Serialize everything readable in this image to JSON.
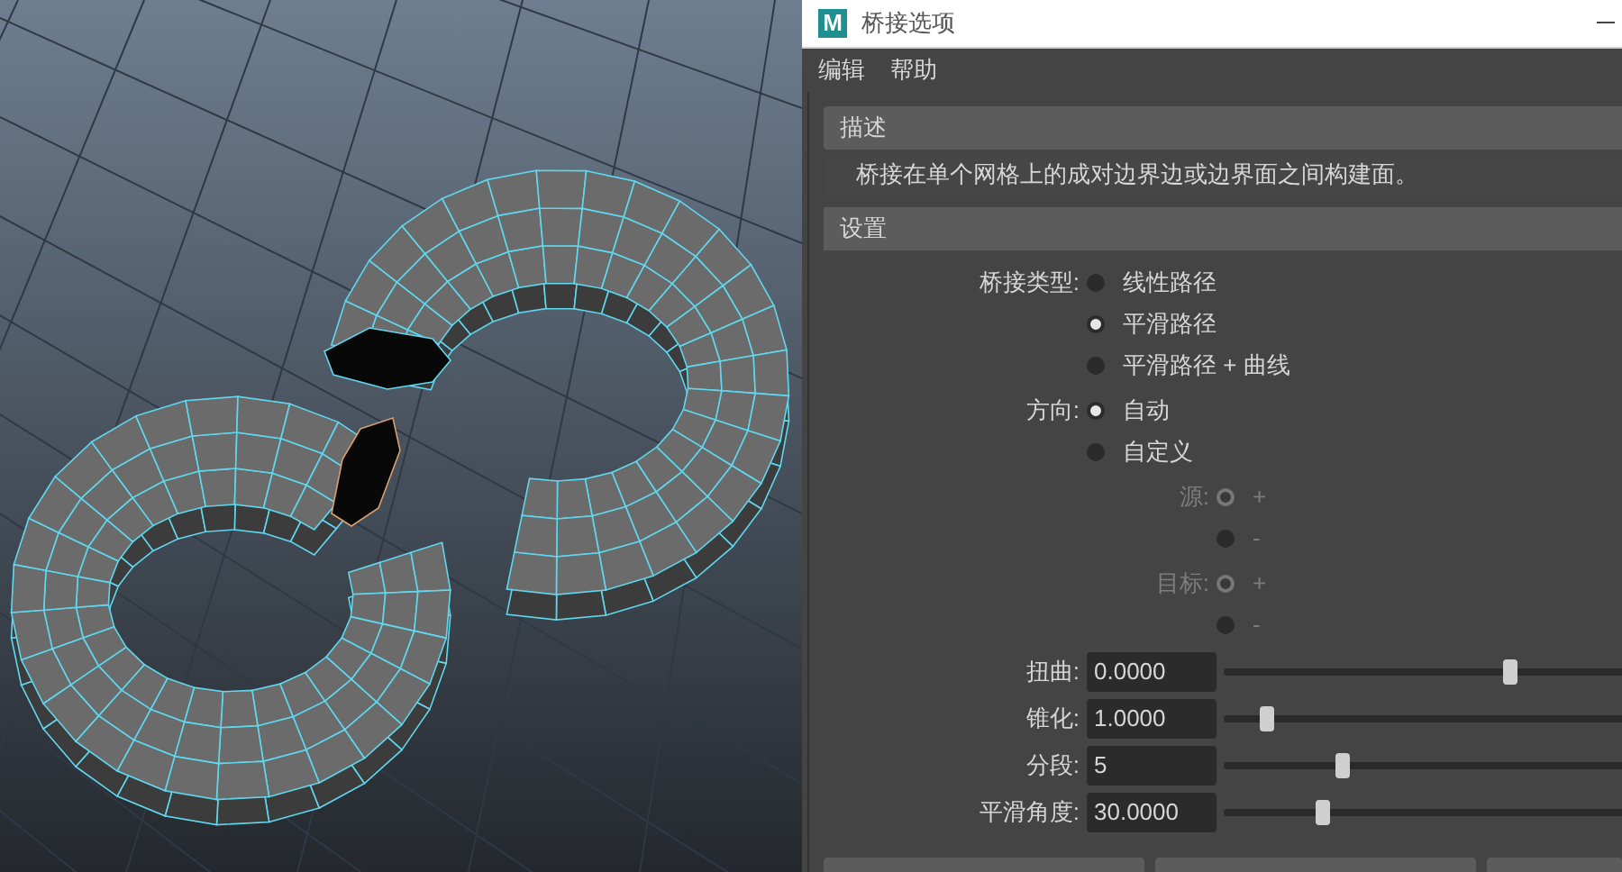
{
  "window": {
    "title": "桥接选项",
    "app_icon_text": "M"
  },
  "menu": [
    {
      "label": "编辑"
    },
    {
      "label": "帮助"
    }
  ],
  "description": {
    "title": "描述",
    "text": "桥接在单个网格上的成对边界边或边界面之间构建面。"
  },
  "settings": {
    "title": "设置",
    "rows": [
      {
        "kind": "radio",
        "label": "桥接类型:",
        "disabled": false,
        "options": [
          {
            "label": "线性路径",
            "selected": false
          },
          {
            "label": "平滑路径",
            "selected": true
          },
          {
            "label": "平滑路径 + 曲线",
            "selected": false
          }
        ]
      },
      {
        "kind": "radio",
        "label": "方向:",
        "disabled": false,
        "options": [
          {
            "label": "自动",
            "selected": true
          },
          {
            "label": "自定义",
            "selected": false
          }
        ]
      },
      {
        "kind": "sub_radio",
        "label": "源:",
        "disabled": true,
        "options": [
          {
            "label": "+",
            "selected": true
          },
          {
            "label": "-",
            "selected": false
          }
        ]
      },
      {
        "kind": "sub_radio",
        "label": "目标:",
        "disabled": true,
        "options": [
          {
            "label": "+",
            "selected": true
          },
          {
            "label": "-",
            "selected": false
          }
        ]
      },
      {
        "kind": "slider",
        "label": "扭曲:",
        "value": "0.0000",
        "level": 0.72
      },
      {
        "kind": "slider",
        "label": "锥化:",
        "value": "1.0000",
        "level": 0.11
      },
      {
        "kind": "slider",
        "label": "分段:",
        "value": "5",
        "level": 0.3
      },
      {
        "kind": "slider",
        "label": "平滑角度:",
        "value": "30.0000",
        "level": 0.25
      }
    ]
  }
}
